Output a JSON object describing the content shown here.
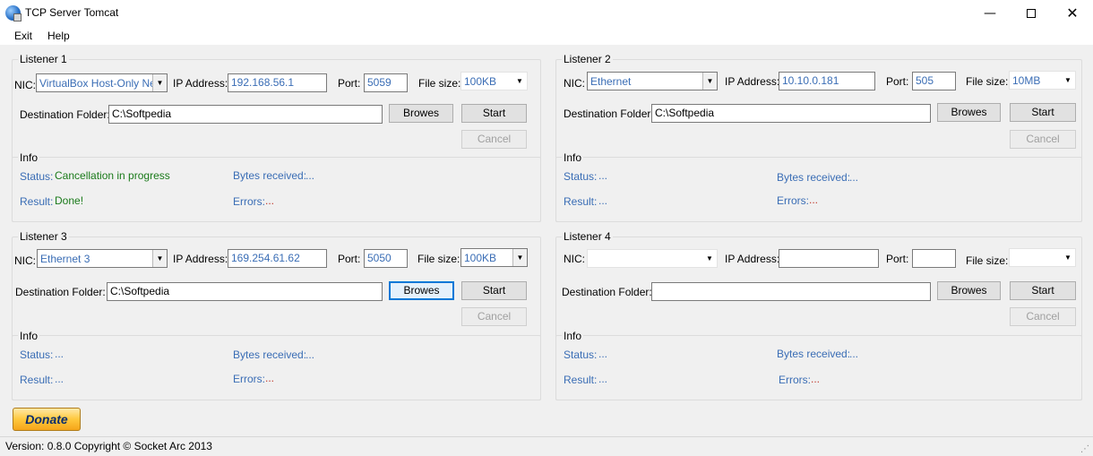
{
  "window": {
    "title": "TCP Server Tomcat",
    "controls": {
      "minimize": "—",
      "close": "✕"
    }
  },
  "menu": [
    "Exit",
    "Help"
  ],
  "labels": {
    "nic": "NIC:",
    "ip": "IP Address:",
    "port": "Port:",
    "filesize": "File size:",
    "dest": "Destination Folder:",
    "browse": "Browes",
    "start": "Start",
    "cancel": "Cancel",
    "info": "Info",
    "status": "Status:",
    "result": "Result:",
    "bytes": "Bytes received:",
    "errors": "Errors:"
  },
  "listeners": [
    {
      "title": "Listener 1",
      "nic": "VirtualBox Host-Only Network",
      "ip": "192.168.56.1",
      "port": "5059",
      "filesize": "100KB",
      "dest": "C:\\Softpedia",
      "status": "Cancellation in progress",
      "result": "Done!",
      "bytes": "...",
      "errors": "..."
    },
    {
      "title": "Listener 2",
      "nic": "Ethernet",
      "ip": "10.10.0.181",
      "port": "505",
      "filesize": "10MB",
      "dest": "C:\\Softpedia",
      "status": "...",
      "result": "...",
      "bytes": "...",
      "errors": "..."
    },
    {
      "title": "Listener 3",
      "nic": "Ethernet 3",
      "ip": "169.254.61.62",
      "port": "5050",
      "filesize": "100KB",
      "dest": "C:\\Softpedia",
      "status": "...",
      "result": "...",
      "bytes": "...",
      "errors": "..."
    },
    {
      "title": "Listener 4",
      "nic": "",
      "ip": "",
      "port": "",
      "filesize": "",
      "dest": "",
      "status": "...",
      "result": "...",
      "bytes": "...",
      "errors": "..."
    }
  ],
  "donate_label": "Donate",
  "statusbar": {
    "text": "Version: 0.8.0 Copyright © Socket Arc 2013"
  },
  "colors": {
    "accent": "#3a6db5",
    "success": "#1a7a1a",
    "error_dots": "#c0392b",
    "focus": "#0078d7"
  }
}
